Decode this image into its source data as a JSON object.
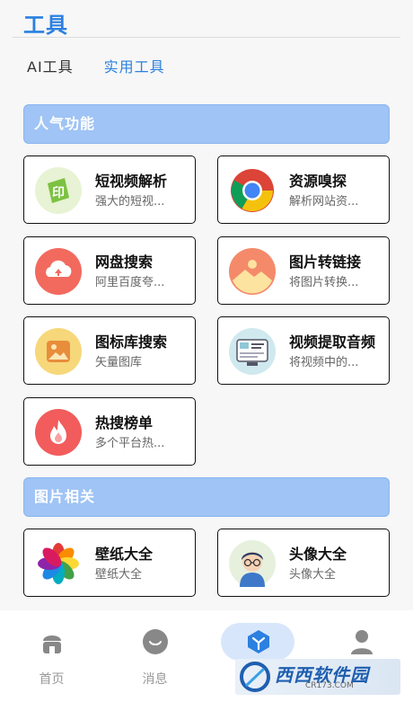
{
  "header": {
    "title": "工具"
  },
  "tabs": [
    {
      "label": "AI工具",
      "active": false
    },
    {
      "label": "实用工具",
      "active": true
    }
  ],
  "sections": [
    {
      "title": "人气功能",
      "cards": [
        {
          "title": "短视频解析",
          "desc": "强大的短视...",
          "icon": "video-parse-icon"
        },
        {
          "title": "资源嗅探",
          "desc": "解析网站资...",
          "icon": "chrome-icon"
        },
        {
          "title": "网盘搜索",
          "desc": "阿里百度夸...",
          "icon": "cloud-upload-icon"
        },
        {
          "title": "图片转链接",
          "desc": "将图片转换...",
          "icon": "image-icon"
        },
        {
          "title": "图标库搜索",
          "desc": "矢量图库",
          "icon": "gallery-icon"
        },
        {
          "title": "视频提取音频",
          "desc": "将视频中的...",
          "icon": "video-audio-icon"
        },
        {
          "title": "热搜榜单",
          "desc": "多个平台热...",
          "icon": "fire-icon"
        }
      ]
    },
    {
      "title": "图片相关",
      "cards": [
        {
          "title": "壁纸大全",
          "desc": "壁纸大全",
          "icon": "petal-icon"
        },
        {
          "title": "头像大全",
          "desc": "头像大全",
          "icon": "avatar-boy-icon"
        }
      ]
    }
  ],
  "bottom_nav": [
    {
      "label": "首页",
      "icon": "home-icon"
    },
    {
      "label": "消息",
      "icon": "message-icon"
    },
    {
      "label": "",
      "icon": "tools-icon",
      "active": true
    },
    {
      "label": "",
      "icon": "user-icon"
    }
  ],
  "watermark": {
    "text": "西西软件园",
    "url": "CR173.COM"
  },
  "colors": {
    "accent": "#2b80e0",
    "section_bar": "#9fc4f5",
    "nav_pill": "#d8e6fb"
  }
}
